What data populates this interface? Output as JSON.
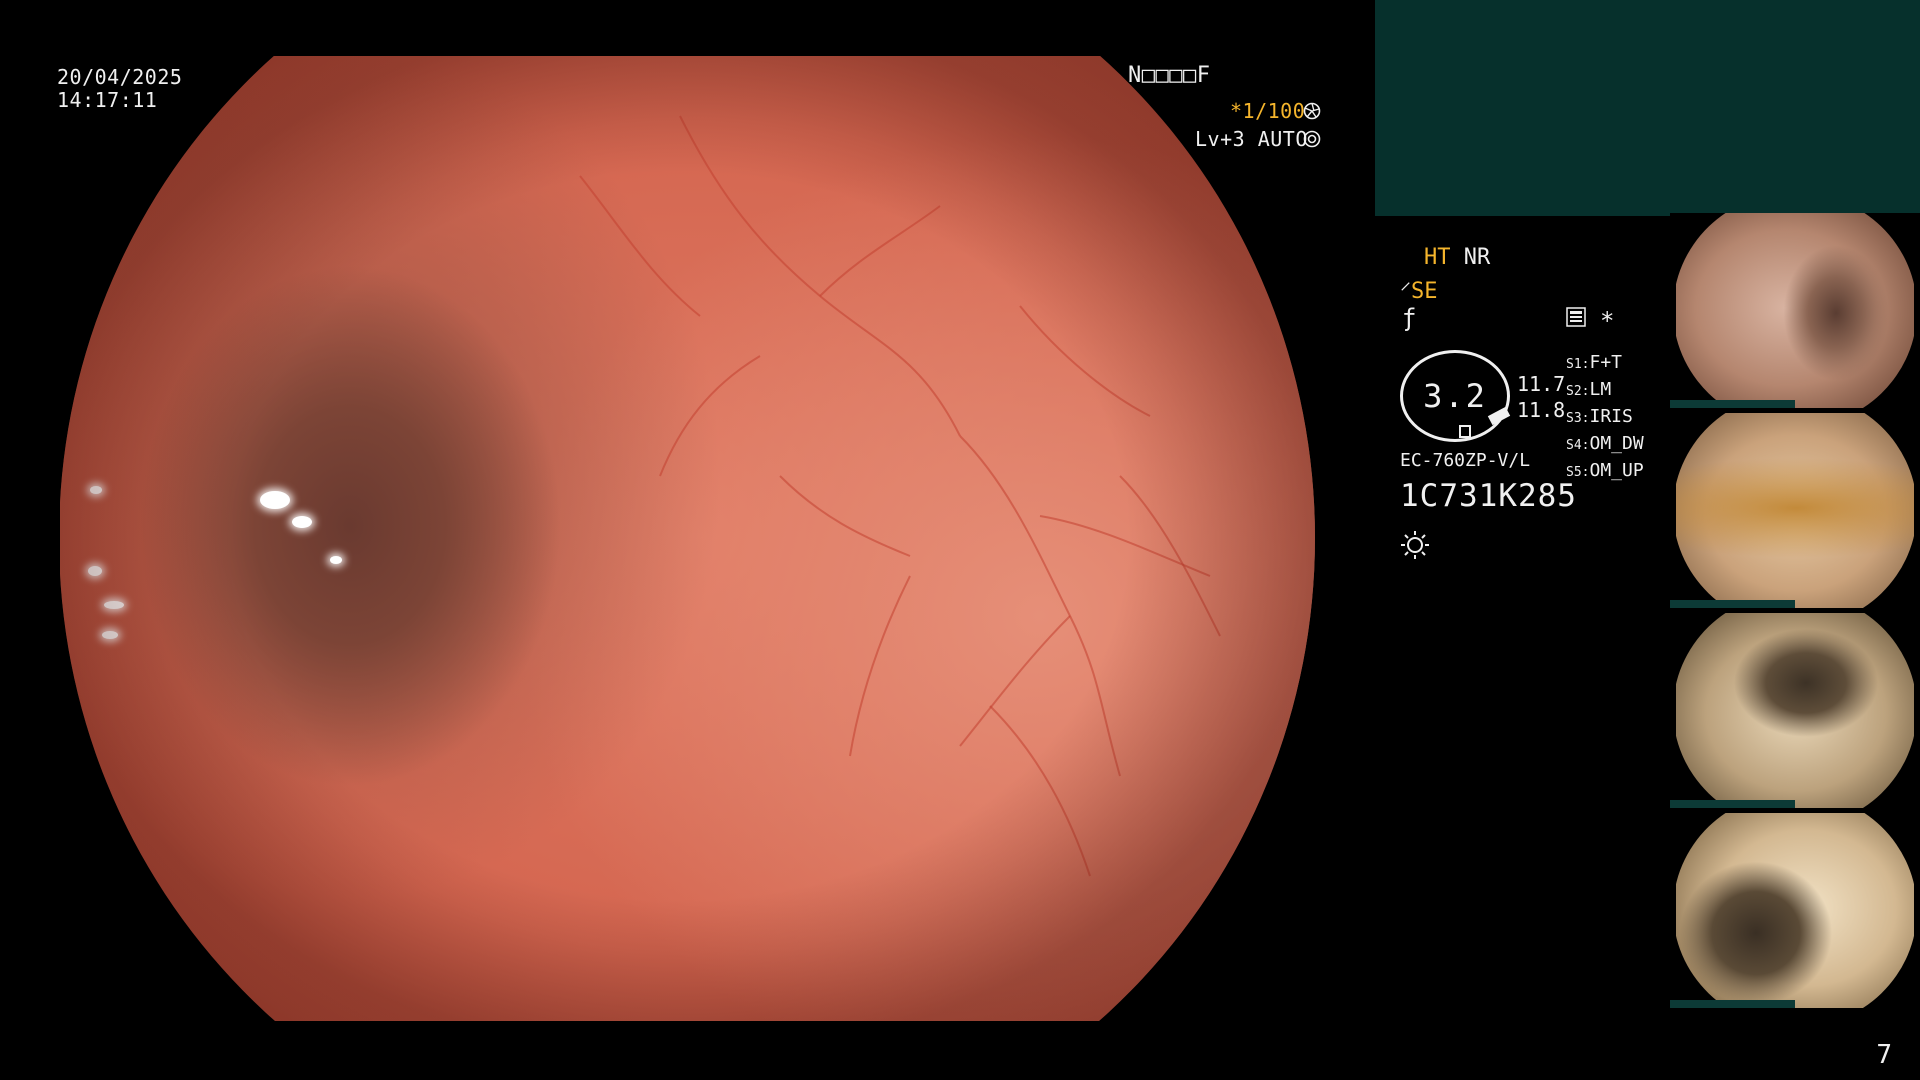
{
  "overlay": {
    "date": "20/04/2025",
    "time": "14:17:11",
    "header_code": "N□□□□F",
    "shutter": "*1/100",
    "shutter_icon": "aperture-icon",
    "level": "Lv+3 AUTO",
    "level_icon": "target-icon"
  },
  "sidebar": {
    "mode_ht": "HT",
    "mode_nr": "NR",
    "se_symbol": "⸍",
    "se_label": "SE",
    "f_symbol": "ƒ",
    "memory_icon": "memory-card-icon",
    "star": "*",
    "zoom_value": "3.2",
    "zoom_high": "11.7",
    "zoom_low": "11.8",
    "scope_model": "EC-760ZP-V/L",
    "serial": "1C731K285",
    "light_icon": "sun-icon",
    "switches": [
      {
        "key": "S1:",
        "value": "F+T"
      },
      {
        "key": "S2:",
        "value": "LM"
      },
      {
        "key": "S3:",
        "value": "IRIS"
      },
      {
        "key": "S4:",
        "value": "OM_DW"
      },
      {
        "key": "S5:",
        "value": "OM_UP"
      }
    ]
  },
  "colors": {
    "accent_yellow": "#f5b52c",
    "panel_teal": "#06302c",
    "text": "#f0f0f0"
  },
  "page_number": "7"
}
